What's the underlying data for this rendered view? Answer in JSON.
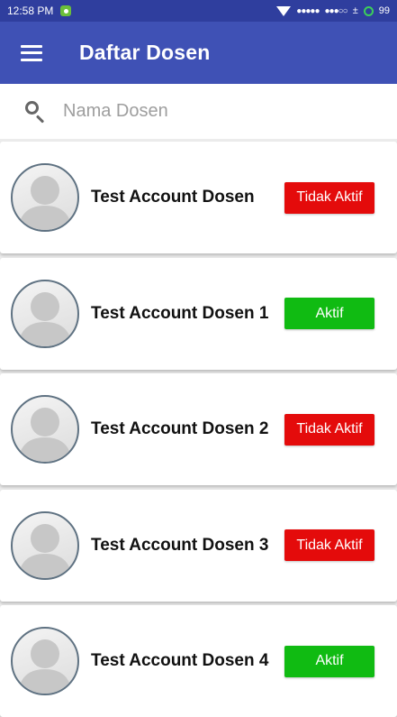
{
  "status_bar": {
    "time": "12:58 PM",
    "signal1": "●●●●●",
    "signal2": "●●●○○",
    "extra": "±",
    "battery": "99"
  },
  "appbar": {
    "title": "Daftar Dosen"
  },
  "search": {
    "placeholder": "Nama Dosen",
    "value": ""
  },
  "colors": {
    "appbar": "#3f51b5",
    "statusbar": "#2f3e9e",
    "inactive": "#e40b0b",
    "active": "#10bb12"
  },
  "dosen": [
    {
      "name": "Test Account Dosen",
      "status": "Tidak Aktif"
    },
    {
      "name": "Test Account Dosen 1",
      "status": "Aktif"
    },
    {
      "name": "Test Account Dosen 2",
      "status": "Tidak Aktif"
    },
    {
      "name": "Test Account Dosen 3",
      "status": "Tidak Aktif"
    },
    {
      "name": "Test Account Dosen 4",
      "status": "Aktif"
    }
  ]
}
